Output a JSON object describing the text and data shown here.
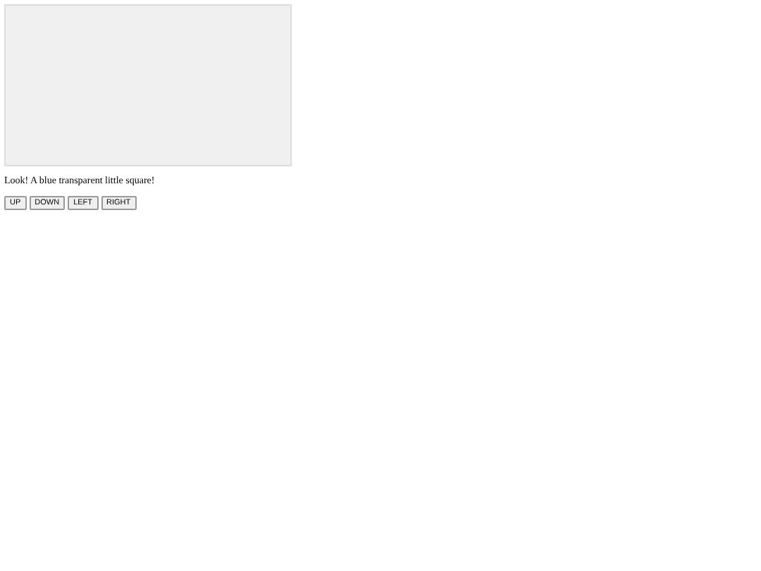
{
  "caption": "Look! A blue transparent little square!",
  "buttons": [
    "UP",
    "DOWN",
    "LEFT",
    "RIGHT"
  ]
}
